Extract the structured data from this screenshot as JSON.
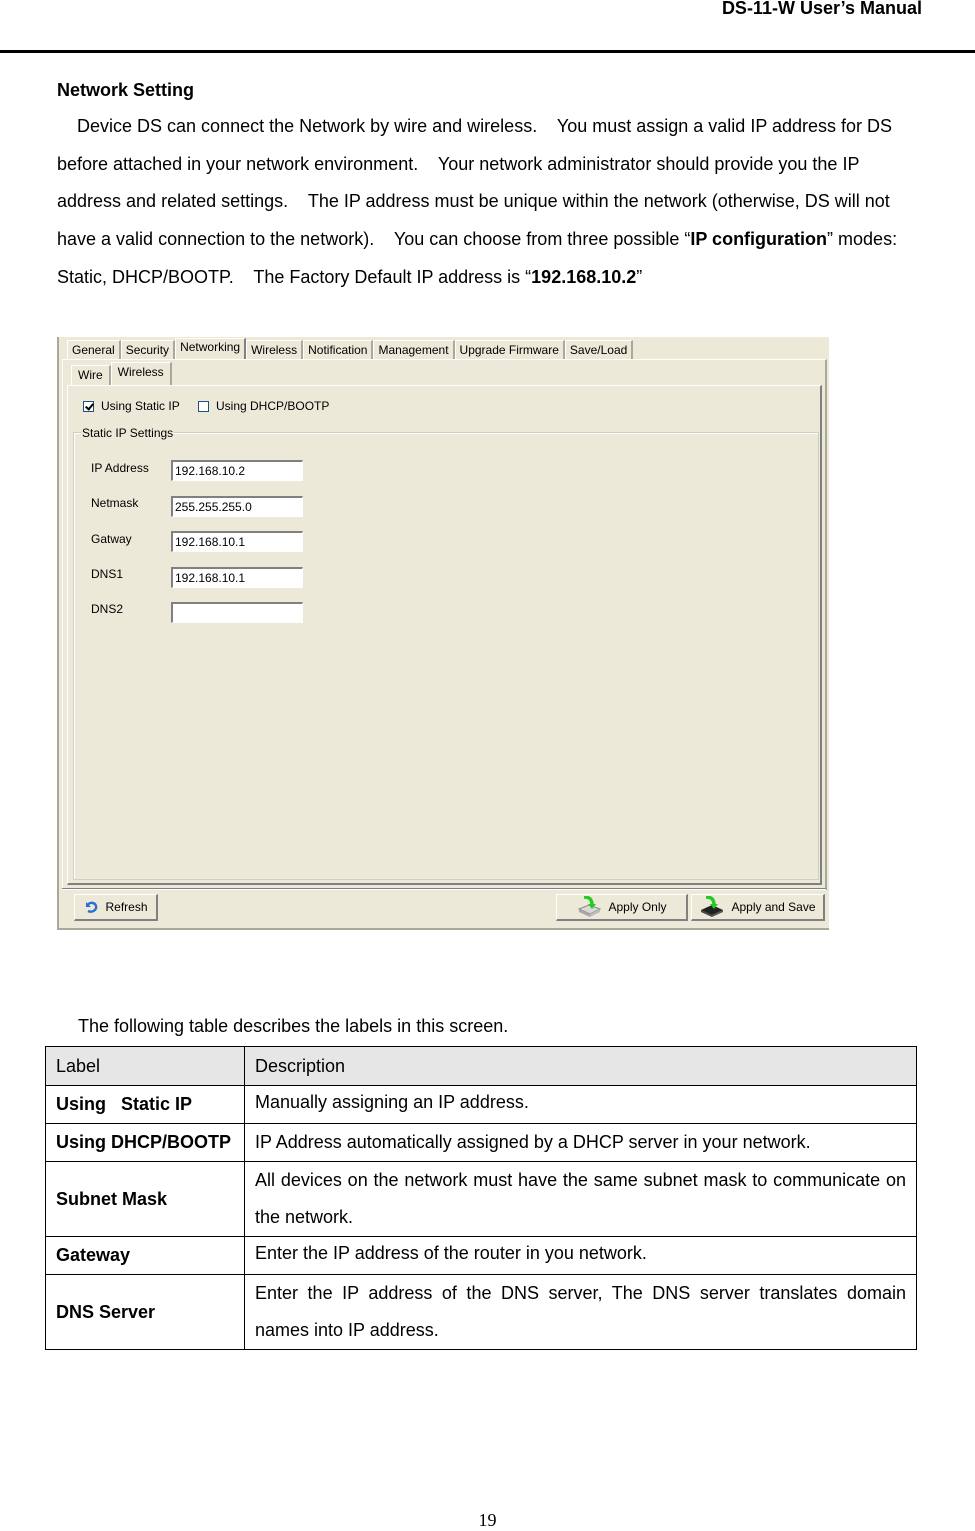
{
  "header": {
    "title": "DS-11-W User’s Manual"
  },
  "section": {
    "title": "Network Setting",
    "intro_parts": [
      "Device DS can connect the Network by wire and wireless.    You must assign a valid IP address for DS before attached in your network environment.    Your network administrator should provide you the IP address and related settings.    The IP address must be unique within the network (otherwise, DS will not have a valid connection to the network).    You can choose from three possible “",
      "IP configuration",
      "” modes: Static, DHCP/BOOTP.    The Factory Default IP address is “",
      "192.168.10.2",
      "”"
    ]
  },
  "dialog": {
    "tabs": [
      "General",
      "Security",
      "Networking",
      "Wireless",
      "Notification",
      "Management",
      "Upgrade Firmware",
      "Save/Load"
    ],
    "active_tab": "Networking",
    "subtabs": [
      "Wire",
      "Wireless"
    ],
    "active_subtab": "Wireless",
    "checkboxes": [
      {
        "label": "Using Static IP",
        "checked": true
      },
      {
        "label": "Using DHCP/BOOTP",
        "checked": false
      }
    ],
    "group_title": "Static IP Settings",
    "fields": [
      {
        "label": "IP Address",
        "value": "192.168.10.2"
      },
      {
        "label": "Netmask",
        "value": "255.255.255.0"
      },
      {
        "label": "Gatway",
        "value": "192.168.10.1"
      },
      {
        "label": "DNS1",
        "value": "192.168.10.1"
      },
      {
        "label": "DNS2",
        "value": ""
      }
    ],
    "buttons": {
      "refresh": {
        "label": "Refresh",
        "icon": "refresh-icon"
      },
      "apply_only": {
        "label": "Apply Only",
        "icon": "apply-drive-icon"
      },
      "apply_save": {
        "label": "Apply and Save",
        "icon": "apply-chip-icon"
      }
    }
  },
  "table": {
    "intro": "The following table describes the labels in this screen.",
    "headers": [
      "Label",
      "Description"
    ],
    "rows": [
      {
        "label": "Using   Static IP",
        "description": "Manually assigning an IP address."
      },
      {
        "label": "Using DHCP/BOOTP",
        "description": "IP Address automatically assigned by a DHCP server in your network."
      },
      {
        "label": "Subnet Mask",
        "description": "All devices on the network must have the same subnet mask to communicate on the network."
      },
      {
        "label": "Gateway",
        "description": "Enter the IP address of the router in you network."
      },
      {
        "label": "DNS Server",
        "description": "Enter the IP address of the DNS server, The DNS server translates domain names into IP address."
      }
    ]
  },
  "footer": {
    "page_number": "19"
  }
}
